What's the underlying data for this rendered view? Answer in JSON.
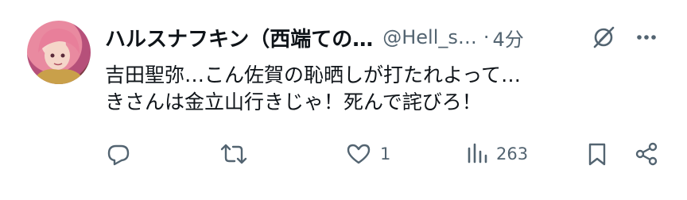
{
  "tweet": {
    "display_name": "ハルスナフキン（西端ての…",
    "handle": "@Hell_s…",
    "separator": "·",
    "time": "4分",
    "text_lines": [
      "吉田聖弥…こん佐賀の恥晒しが打たれよって…",
      "きさんは金立山行きじゃ！死んで詫びろ！"
    ]
  },
  "actions": {
    "reply_count": "",
    "retweet_count": "",
    "like_count": "1",
    "view_count": "263"
  },
  "icons": {
    "avatar": "avatar-image",
    "grok": "grok-icon",
    "more": "more-icon",
    "reply": "reply-icon",
    "retweet": "retweet-icon",
    "like": "heart-icon",
    "views": "views-icon",
    "bookmark": "bookmark-icon",
    "share": "share-icon"
  },
  "colors": {
    "text": "#0f1419",
    "secondary": "#536471",
    "background": "#ffffff"
  }
}
